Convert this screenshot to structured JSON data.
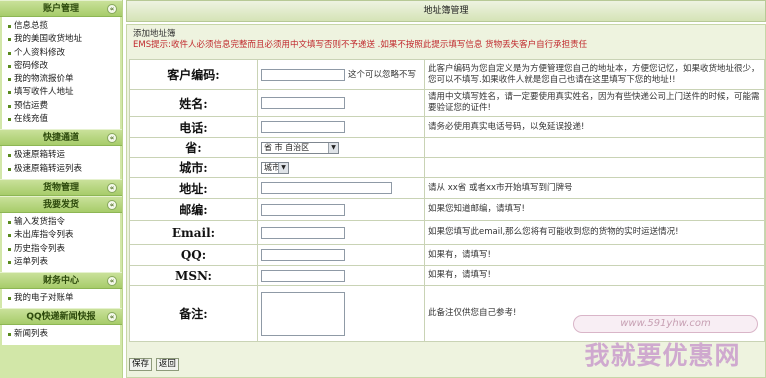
{
  "sidebar": {
    "sections": [
      {
        "title": "账户管理",
        "items": [
          "信息总揽",
          "我的美国收货地址",
          "个人资料修改",
          "密码修改",
          "我的物流报价单",
          "填写收件人地址",
          "预估运费",
          "在线充值"
        ]
      },
      {
        "title": "快捷通道",
        "items": [
          "极速原箱转运",
          "极速原箱转运列表"
        ]
      },
      {
        "title": "货物管理",
        "items": []
      },
      {
        "title": "我要发货",
        "items": [
          "输入发货指令",
          "未出库指令列表",
          "历史指令列表",
          "运单列表"
        ]
      },
      {
        "title": "财务中心",
        "items": [
          "我的电子对账单"
        ]
      },
      {
        "title": "QQ快递新闻快报",
        "items": [
          "新闻列表"
        ]
      }
    ]
  },
  "header": {
    "title": "地址簿管理"
  },
  "intro": {
    "heading": "添加地址簿",
    "warning": "EMS提示:收件人必须信息完整而且必须用中文填写否则不予递送 .如果不按照此提示填写信息 货物丢失客户自行承担责任"
  },
  "form": {
    "rows": [
      {
        "label": "客户编码:",
        "control": "input",
        "inline_hint": "这个可以忽略不写",
        "tip": "此客户编码为您自定义是为方便管理您自己的地址本，方便您记忆，如果收货地址很少，您可以不填写.如果收件人就是您自己也请在这里填写下您的地址!!"
      },
      {
        "label": "姓名:",
        "control": "input",
        "tip": "请用中文填写姓名，请一定要使用真实姓名，因为有些快递公司上门送件的时候，可能需要验证您的证件!"
      },
      {
        "label": "电话:",
        "control": "input",
        "tip": "请务必使用真实电话号码，以免延误投递!"
      },
      {
        "label": "省:",
        "control": "select",
        "selected": "省 市 自治区",
        "tip": ""
      },
      {
        "label": "城市:",
        "control": "select",
        "selected": "城市",
        "tip": ""
      },
      {
        "label": "地址:",
        "control": "input-wide",
        "tip": "请从 xx省 或者xx市开始填写到门牌号"
      },
      {
        "label": "邮编:",
        "control": "input",
        "tip": "如果您知道邮编，请填写!"
      },
      {
        "label": "Email:",
        "control": "input",
        "tip": "如果您填写此email,那么您将有可能收到您的货物的实时运送情况!"
      },
      {
        "label": "QQ:",
        "control": "input",
        "tip": "如果有，请填写!"
      },
      {
        "label": "MSN:",
        "control": "input",
        "tip": "如果有，请填写!"
      },
      {
        "label": "备注:",
        "control": "textarea",
        "tip": "此备注仅供您自己参考!"
      }
    ]
  },
  "actions": {
    "save_label": "保存",
    "back_label": "返回"
  },
  "watermark": {
    "url": "www.591yhw.com",
    "text": "我就要优惠网"
  },
  "colors": {
    "sidebar_bg": "#d2e7a8",
    "panel_bg": "#eef3df",
    "warning": "#c0282c"
  }
}
